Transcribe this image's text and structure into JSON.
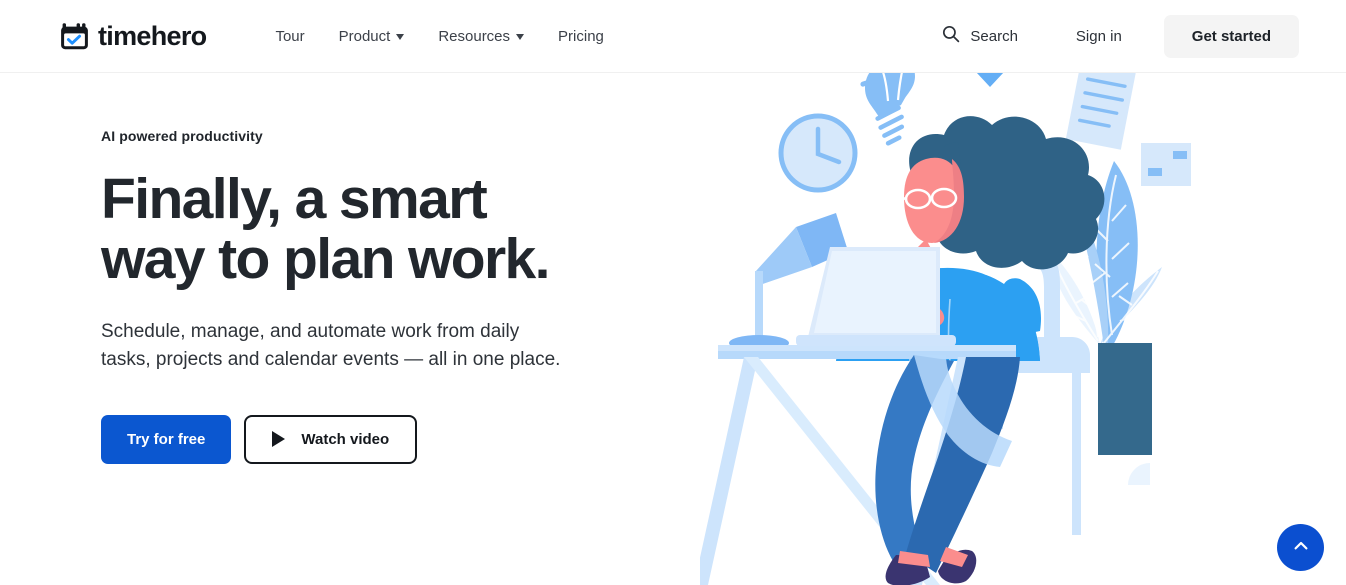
{
  "brand": {
    "name": "timehero",
    "logo_icon": "calendar-check-icon",
    "accent_blue": "#0b57d0",
    "logo_check_color": "#1e90ff"
  },
  "nav": {
    "items": [
      {
        "label": "Tour",
        "has_dropdown": false
      },
      {
        "label": "Product",
        "has_dropdown": true
      },
      {
        "label": "Resources",
        "has_dropdown": true
      },
      {
        "label": "Pricing",
        "has_dropdown": false
      }
    ]
  },
  "header_right": {
    "search_label": "Search",
    "search_icon": "search-icon",
    "signin_label": "Sign in",
    "get_started_label": "Get started",
    "get_started_bg": "#f4f4f4"
  },
  "hero": {
    "eyebrow": "AI powered productivity",
    "headline": "Finally, a smart\nway to plan work.",
    "subhead": "Schedule, manage, and automate work from daily\ntasks, projects and calendar events — all in one place.",
    "primary_cta": "Try for free",
    "secondary_cta": "Watch video",
    "secondary_cta_icon": "play-icon"
  },
  "illustration": {
    "name": "woman-working-at-desk-illustration",
    "elements": [
      "clock-icon",
      "lightbulb-icon",
      "desk-lamp",
      "laptop",
      "desk",
      "document-page",
      "note-card",
      "chair",
      "potted-plant",
      "triangle-accent"
    ],
    "palette": {
      "hair_teal": "#2f6286",
      "shirt_blue": "#2ca0f2",
      "skin_pink": "#fb8d8d",
      "skin_shadow": "#e8787d",
      "jeans_blue": "#3579c4",
      "jeans_dark": "#2b69b0",
      "shoe_navy": "#3a3470",
      "light_blue": "#d6e8fb",
      "mid_blue": "#86bef6",
      "pale_blue": "#eaf4fe",
      "pot_teal": "#34698c"
    }
  },
  "scroll_top": {
    "icon": "chevron-up-icon",
    "color": "#0b4fd0",
    "label": "Back to top"
  }
}
